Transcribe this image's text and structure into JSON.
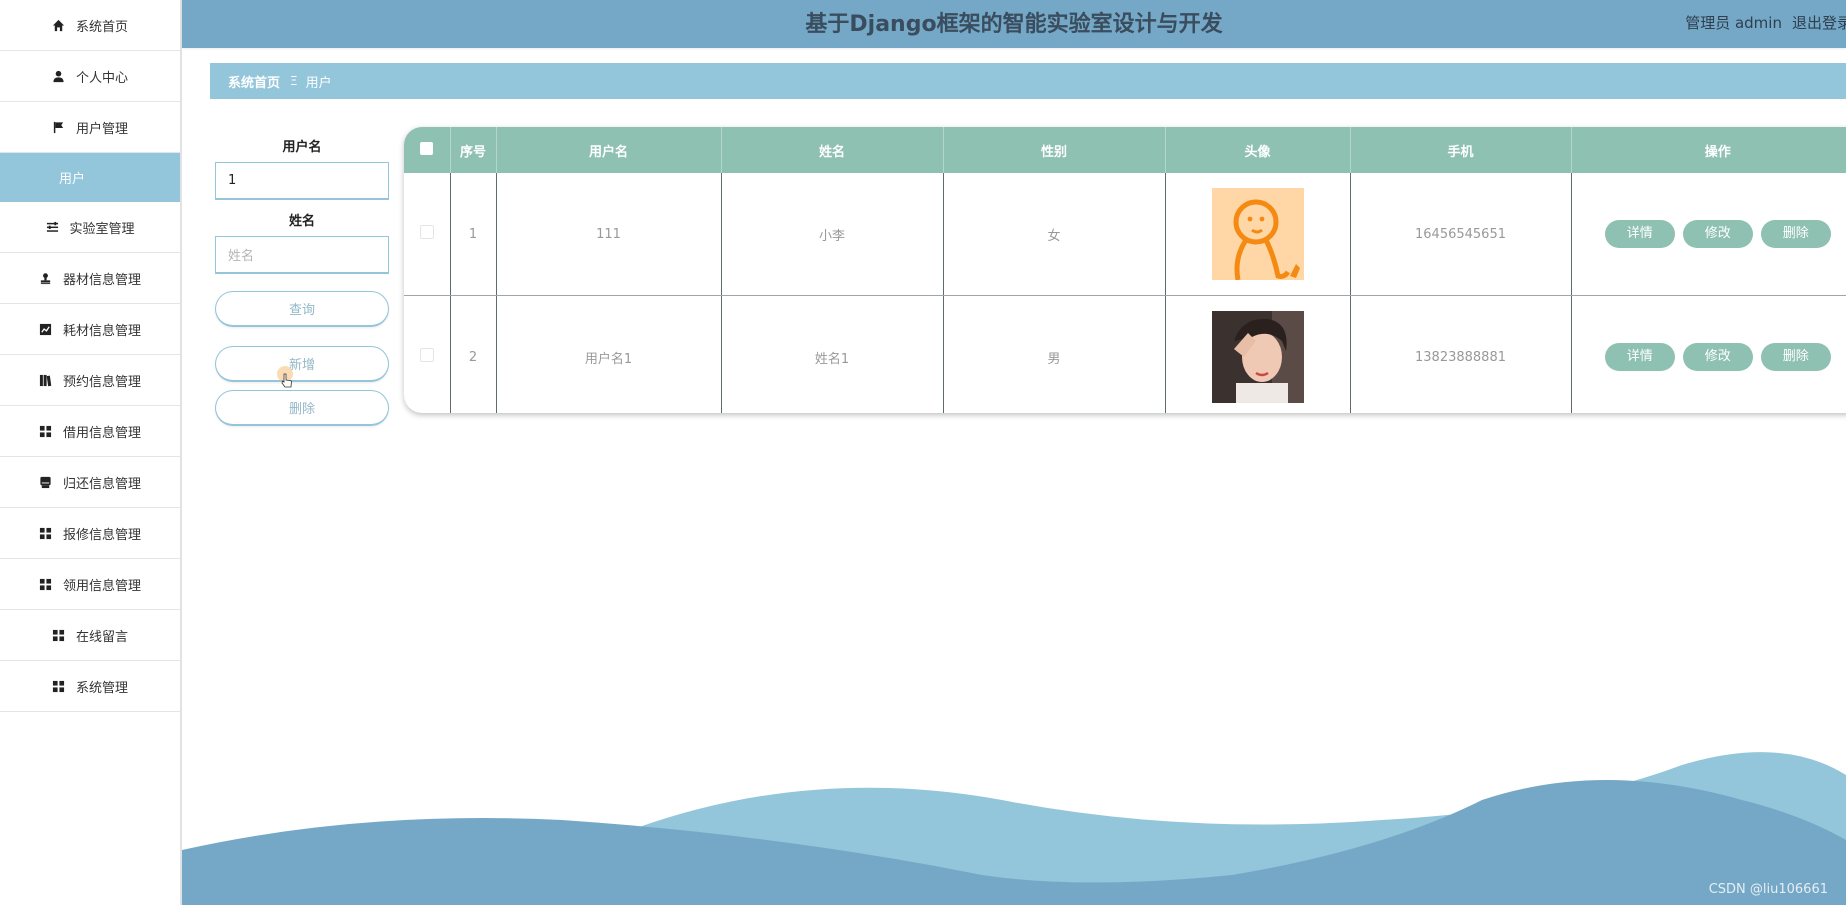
{
  "header": {
    "title": "基于Django框架的智能实验室设计与开发",
    "user_label": "管理员 admin",
    "logout_label": "退出登录"
  },
  "sidebar": {
    "items": [
      {
        "label": "系统首页",
        "icon": "home-icon"
      },
      {
        "label": "个人中心",
        "icon": "person-icon"
      },
      {
        "label": "用户管理",
        "icon": "flag-icon"
      },
      {
        "label": "用户",
        "icon": "",
        "sub": true
      },
      {
        "label": "实验室管理",
        "icon": "sliders-icon"
      },
      {
        "label": "器材信息管理",
        "icon": "stamp-icon"
      },
      {
        "label": "耗材信息管理",
        "icon": "chart-icon"
      },
      {
        "label": "预约信息管理",
        "icon": "book-icon"
      },
      {
        "label": "借用信息管理",
        "icon": "grid-icon"
      },
      {
        "label": "归还信息管理",
        "icon": "drive-icon"
      },
      {
        "label": "报修信息管理",
        "icon": "grid-icon"
      },
      {
        "label": "领用信息管理",
        "icon": "grid-icon"
      },
      {
        "label": "在线留言",
        "icon": "grid-icon"
      },
      {
        "label": "系统管理",
        "icon": "grid-icon"
      }
    ]
  },
  "breadcrumb": {
    "home": "系统首页",
    "separator": "Ξ",
    "current": "用户"
  },
  "search": {
    "username_label": "用户名",
    "username_value": "1",
    "name_label": "姓名",
    "name_placeholder": "姓名",
    "query_label": "查询",
    "add_label": "新增",
    "delete_label": "删除"
  },
  "table": {
    "headers": [
      "序号",
      "用户名",
      "姓名",
      "性别",
      "头像",
      "手机",
      "操作"
    ],
    "rows": [
      {
        "index": "1",
        "username": "111",
        "name": "小李",
        "gender": "女",
        "avatar": "cartoon-avatar",
        "phone": "16456545651"
      },
      {
        "index": "2",
        "username": "用户名1",
        "name": "姓名1",
        "gender": "男",
        "avatar": "photo-avatar",
        "phone": "13823888881"
      }
    ],
    "actions": {
      "detail": "详情",
      "edit": "修改",
      "delete": "删除"
    }
  },
  "watermark": "CSDN @liu106661",
  "colors": {
    "header": "#74a8c6",
    "breadcrumb": "#93c6da",
    "table_header": "#8fc1b2",
    "wave_dark": "#74a8c6",
    "wave_light": "#93c6da"
  }
}
